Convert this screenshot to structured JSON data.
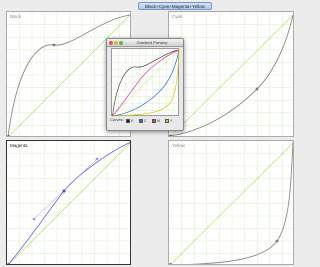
{
  "window": {
    "title": "Black+Cyan+Magenta+Yellow"
  },
  "panels": [
    {
      "label": "Black"
    },
    {
      "label": "Cyan"
    },
    {
      "label": "Magenta"
    },
    {
      "label": "Yellow"
    }
  ],
  "floating": {
    "title": "Gradient Preview",
    "curves_label": "Curves:",
    "checkboxes": [
      {
        "label": "K",
        "color": "#1a1a1a",
        "checked": true
      },
      {
        "label": "C",
        "color": "#2b6fd6",
        "checked": true
      },
      {
        "label": "M",
        "color": "#d43aa6",
        "checked": true
      },
      {
        "label": "Y",
        "color": "#d9c821",
        "checked": true
      }
    ]
  },
  "colors": {
    "grid": "#cfe7b8",
    "diagonal": "#b2e27a",
    "curve": "#8a8a8a",
    "active_curve": "#7b6fe0"
  }
}
